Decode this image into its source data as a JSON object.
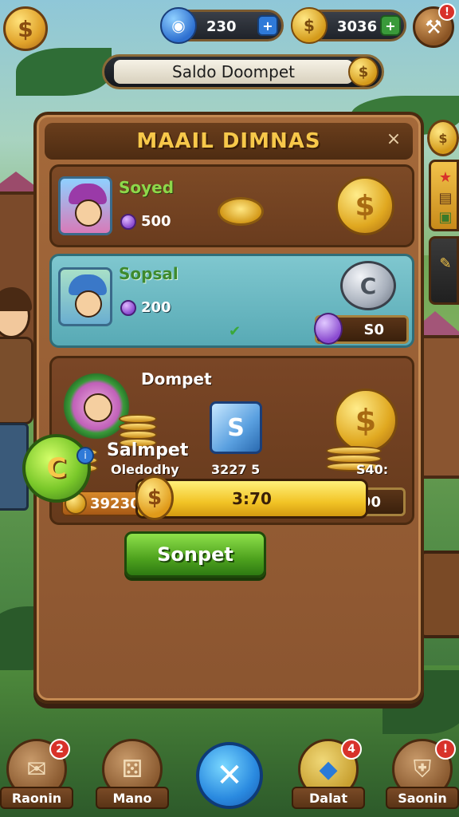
{
  "topbar": {
    "gem_value": "230",
    "gold_value": "3036",
    "coin_btn_icon": "dollar-coin-icon",
    "settings_icon": "hammer-icon",
    "settings_badge": "!"
  },
  "wallet_banner": {
    "label": "Saldo Doompet"
  },
  "panel": {
    "title": "MAAIL DIMNAS",
    "close": "×"
  },
  "card1": {
    "name": "Soyed",
    "gem_value": "500"
  },
  "card2": {
    "name": "Sopsal",
    "gem_value": "200",
    "pill_value": "S0"
  },
  "card3": {
    "title": "Dompet",
    "label_left": "Oledodhy",
    "label_mid": "3227 5",
    "label_right": "S40:",
    "coin_bar_value": "39230",
    "pill_value": "90"
  },
  "salmpet": {
    "title": "Salmpet",
    "progress_label": "3:70",
    "progress_fraction": 1.0
  },
  "main_button": {
    "label": "Sonpet"
  },
  "nav": {
    "items": [
      {
        "label": "Raonin",
        "badge": "2",
        "icon": "scroll-icon"
      },
      {
        "label": "Mano",
        "badge": "",
        "icon": "dice-icon"
      },
      {
        "label": "",
        "badge": "",
        "icon": "close-icon"
      },
      {
        "label": "Dalat",
        "badge": "4",
        "icon": "gem-icon"
      },
      {
        "label": "Saonin",
        "badge": "!",
        "icon": "shield-icon"
      }
    ]
  },
  "colors": {
    "accent_gold": "#f7c84a",
    "button_green": "#4ea21e",
    "panel_brown": "#8b5530",
    "highlight_teal": "#7fc7cf"
  }
}
